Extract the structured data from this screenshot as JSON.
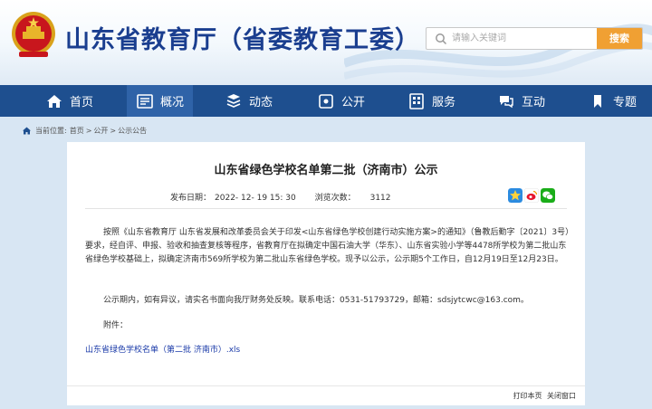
{
  "header": {
    "site_title": "山东省教育厅（省委教育工委）",
    "search_placeholder": "请输入关键词",
    "search_button": "搜索"
  },
  "nav": {
    "items": [
      {
        "label": "首页",
        "icon": "home-icon"
      },
      {
        "label": "概况",
        "icon": "overview-icon",
        "active": true
      },
      {
        "label": "动态",
        "icon": "news-icon"
      },
      {
        "label": "公开",
        "icon": "disclosure-icon"
      },
      {
        "label": "服务",
        "icon": "service-icon"
      },
      {
        "label": "互动",
        "icon": "interaction-icon"
      },
      {
        "label": "专题",
        "icon": "topic-icon"
      }
    ]
  },
  "breadcrumb": {
    "prefix": "当前位置:",
    "items": [
      "首页",
      "公开",
      "公示公告"
    ],
    "separator": ">"
  },
  "article": {
    "title": "山东省绿色学校名单第二批（济南市）公示",
    "publish_label": "发布日期：",
    "publish_date": "2022- 12- 19 15: 30",
    "views_label": "浏览次数：",
    "views": "3112",
    "paragraph1": "按照《山东省教育厅 山东省发展和改革委员会关于印发<山东省绿色学校创建行动实施方案>的通知》（鲁教后勤字〔2021〕3号）要求，经自评、申报、验收和抽查复核等程序，省教育厅在拟确定中国石油大学（华东）、山东省实验小学等4478所学校为第二批山东省绿色学校基础上，拟确定济南市569所学校为第二批山东省绿色学校。现予以公示，公示期5个工作日，自12月19日至12月23日。",
    "paragraph2": "公示期内，如有异议，请实名书面向我厅财务处反映。联系电话：0531-51793729，邮箱：sdsjytcwc@163.com。",
    "attachment_label": "附件：",
    "attachment_link": "山东省绿色学校名单（第二批 济南市）.xls"
  },
  "footer": {
    "print": "打印本页",
    "close": "关闭窗口"
  },
  "colors": {
    "brand_blue": "#1a3e8f",
    "nav_bg": "#1e4f8f",
    "nav_active": "#2f63a8",
    "search_button": "#f0a033",
    "link": "#1a3aa8"
  }
}
